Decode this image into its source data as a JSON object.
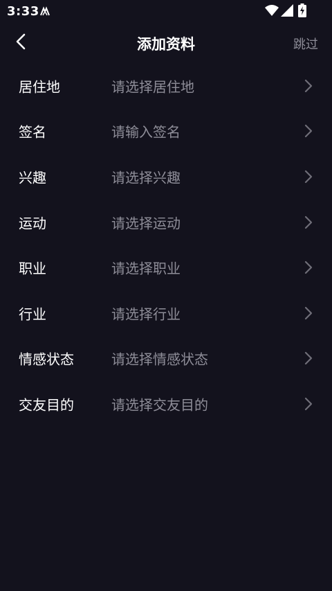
{
  "status_bar": {
    "time": "3:33",
    "app_icon": "notification-app-icon",
    "wifi_icon": "wifi-icon",
    "signal_icon": "cell-signal-icon",
    "battery_icon": "battery-charging-icon"
  },
  "header": {
    "title": "添加资料",
    "skip_label": "跳过",
    "back_icon": "chevron-left-icon"
  },
  "form": {
    "rows": [
      {
        "label": "居住地",
        "placeholder": "请选择居住地"
      },
      {
        "label": "签名",
        "placeholder": "请输入签名"
      },
      {
        "label": "兴趣",
        "placeholder": "请选择兴趣"
      },
      {
        "label": "运动",
        "placeholder": "请选择运动"
      },
      {
        "label": "职业",
        "placeholder": "请选择职业"
      },
      {
        "label": "行业",
        "placeholder": "请选择行业"
      },
      {
        "label": "情感状态",
        "placeholder": "请选择情感状态"
      },
      {
        "label": "交友目的",
        "placeholder": "请选择交友目的"
      }
    ]
  },
  "colors": {
    "background": "#13121d",
    "primary_text": "#ffffff",
    "secondary_text": "#8e8d98",
    "chevron": "#6f6e78"
  }
}
